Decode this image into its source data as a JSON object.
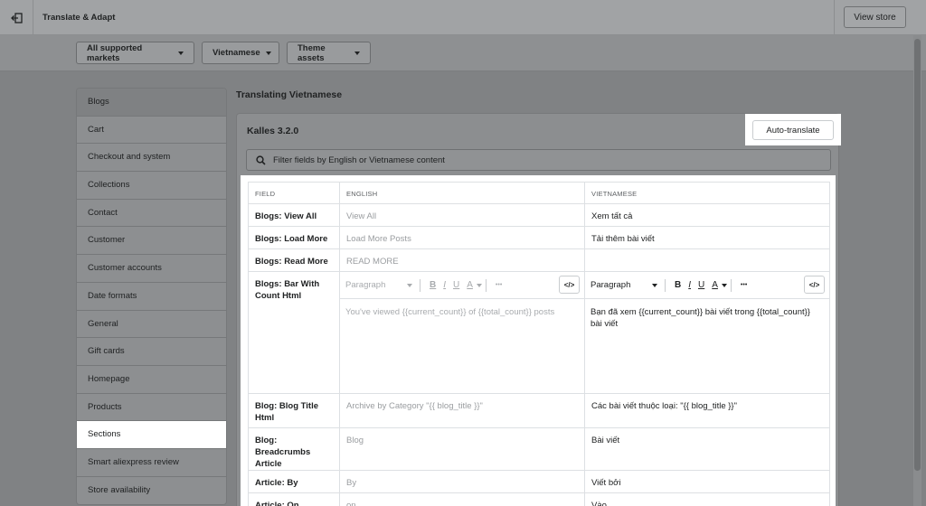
{
  "app": {
    "title": "Translate & Adapt",
    "view_store": "View store"
  },
  "filters": {
    "markets": "All supported markets",
    "language": "Vietnamese",
    "resource": "Theme assets"
  },
  "sidebar": {
    "items": [
      {
        "label": "Blogs"
      },
      {
        "label": "Cart"
      },
      {
        "label": "Checkout and system"
      },
      {
        "label": "Collections"
      },
      {
        "label": "Contact"
      },
      {
        "label": "Customer"
      },
      {
        "label": "Customer accounts"
      },
      {
        "label": "Date formats"
      },
      {
        "label": "General"
      },
      {
        "label": "Gift cards"
      },
      {
        "label": "Homepage"
      },
      {
        "label": "Products"
      },
      {
        "label": "Sections"
      },
      {
        "label": "Smart aliexpress review"
      },
      {
        "label": "Store availability"
      }
    ],
    "active": "Sections"
  },
  "main": {
    "heading": "Translating Vietnamese",
    "card_title": "Kalles 3.2.0",
    "auto_translate": "Auto-translate",
    "search_placeholder": "Filter fields by English or Vietnamese content"
  },
  "table": {
    "headers": {
      "field": "FIELD",
      "english": "ENGLISH",
      "vietnamese": "VIETNAMESE"
    },
    "rows": [
      {
        "field": "Blogs: View All",
        "english": "View All",
        "vietnamese": "Xem tất cả"
      },
      {
        "field": "Blogs: Load More",
        "english": "Load More Posts",
        "vietnamese": "Tải thêm bài viết"
      },
      {
        "field": "Blogs: Read More",
        "english": "READ MORE",
        "vietnamese": ""
      },
      {
        "field": "Blogs: Bar With Count Html",
        "english": "You've viewed {{current_count}} of {{total_count}} posts",
        "vietnamese": "Bạn đã xem {{current_count}} bài viết trong {{total_count}} bài viết"
      },
      {
        "field": "Blog: Blog Title Html",
        "english": "Archive by Category \"{{ blog_title }}\"",
        "vietnamese": "Các bài viết thuộc loại: \"{{ blog_title }}\""
      },
      {
        "field": "Blog: Breadcrumbs Article",
        "english": "Blog",
        "vietnamese": "Bài viết"
      },
      {
        "field": "Article: By",
        "english": "By",
        "vietnamese": "Viết bởi"
      },
      {
        "field": "Article: On",
        "english": "on",
        "vietnamese": "Vào"
      }
    ]
  },
  "editor": {
    "paragraph": "Paragraph",
    "bold": "B",
    "italic": "I",
    "underline": "U",
    "text_color": "A",
    "more": "•••",
    "code": "</>"
  }
}
